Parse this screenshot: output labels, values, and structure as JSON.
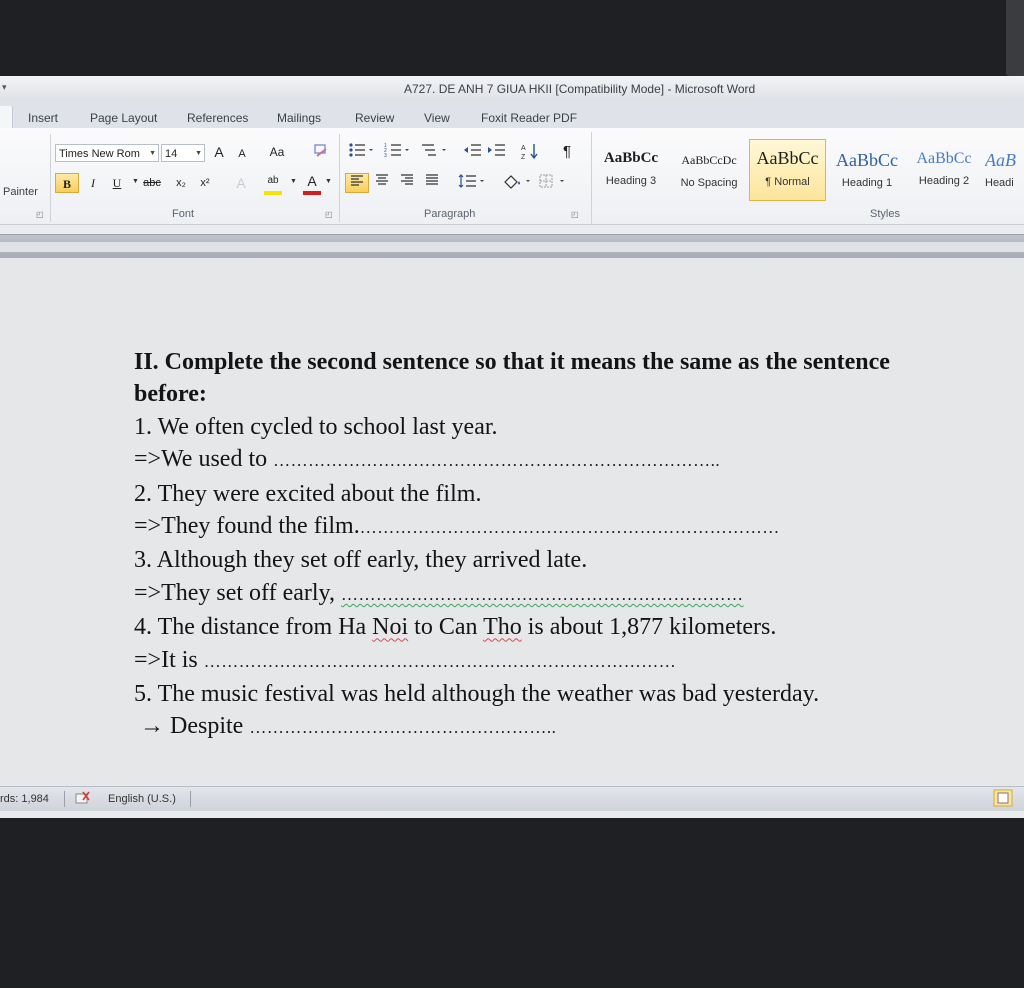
{
  "window": {
    "title": "A727. DE ANH 7 GIUA HKII [Compatibility Mode] - Microsoft Word"
  },
  "tabs": [
    "Insert",
    "Page Layout",
    "References",
    "Mailings",
    "Review",
    "View",
    "Foxit Reader PDF"
  ],
  "ribbon": {
    "clipboard": {
      "painter_label": "Painter"
    },
    "font": {
      "group_label": "Font",
      "font_name": "Times New Rom",
      "font_size": "14",
      "grow_label": "A",
      "shrink_label": "A",
      "case_label": "Aa",
      "clear_label": "A",
      "bold_label": "B",
      "italic_label": "I",
      "underline_label": "U",
      "strike_label": "abc",
      "sub_label": "x₂",
      "super_label": "x²",
      "effects_label": "A",
      "highlight_label": "ab",
      "color_label": "A"
    },
    "paragraph": {
      "group_label": "Paragraph",
      "pilcrow": "¶"
    },
    "styles": {
      "group_label": "Styles",
      "items": [
        {
          "preview": "AaBbCc",
          "name": "Heading 3",
          "selected": false
        },
        {
          "preview": "AaBbCcDc",
          "name": "No Spacing",
          "selected": false
        },
        {
          "preview": "AaBbCc",
          "name": "¶ Normal",
          "selected": true
        },
        {
          "preview": "AaBbCc",
          "name": "Heading 1",
          "selected": false
        },
        {
          "preview": "AaBbCc",
          "name": "Heading 2",
          "selected": false
        },
        {
          "preview": "AaB",
          "name": "Headi",
          "selected": false
        }
      ]
    }
  },
  "document": {
    "heading_line1": "II. Complete the second sentence so that it means the same as the sentence",
    "heading_line2": "before:",
    "items": [
      {
        "question": "1. We often cycled to school last year.",
        "answer_prefix": "=>We used to ",
        "answer_dots": "………………………………………………………………….."
      },
      {
        "question": "2. They were excited about the film.",
        "answer_prefix": "=>They found the film.",
        "answer_dots": "………………………………………………………………"
      },
      {
        "question": "3. Although they set off early, they arrived late.",
        "answer_prefix": "=>They set off early, ",
        "answer_dots": "……………………………………………………………"
      },
      {
        "question_parts": [
          "4. The distance from Ha ",
          "Noi",
          " to Can ",
          "Tho",
          " is about 1,877 kilometers."
        ],
        "answer_prefix": "=>It is ",
        "answer_dots": "………………………………………………………………………"
      },
      {
        "question": "5. The music festival was held although the weather was bad yesterday.",
        "answer_prefix": " → Despite ",
        "answer_dots": "…………………………………………….."
      }
    ]
  },
  "status_bar": {
    "words": "rds: 1,984",
    "language": "English (U.S.)"
  },
  "colors": {
    "accent_selected": "#f7cf5a",
    "heading_blue": "#2f5f9e",
    "spell_red": "#d24b4b",
    "grammar_green": "#3aa45a"
  }
}
